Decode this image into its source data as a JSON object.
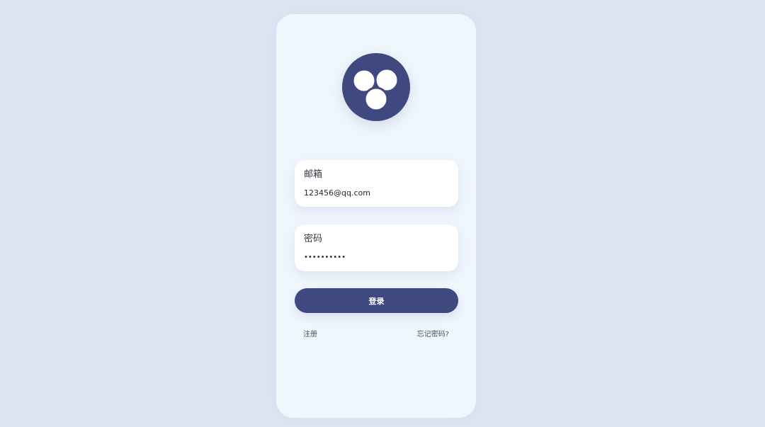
{
  "app": {
    "logo_icon": "three-circles-logo-icon",
    "brand_color": "#3f4980",
    "background_color": "#dde5f2",
    "card_color": "#f0f6fd"
  },
  "form": {
    "email": {
      "label": "邮箱",
      "value": "123456@qq.com"
    },
    "password": {
      "label": "密码",
      "value": "••••••••••"
    },
    "login_button": "登录",
    "register_link": "注册",
    "forgot_link": "忘记密码?"
  }
}
